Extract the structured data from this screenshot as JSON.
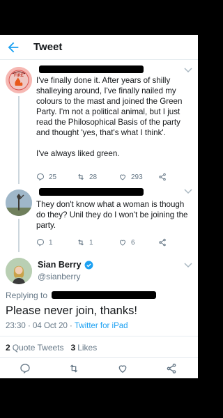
{
  "header": {
    "title": "Tweet"
  },
  "tweet1": {
    "avatar_text": "FIRE",
    "text": "I've finally done it. After years of shilly shalleying around, I've finally nailed my colours to the mast and joined the Green Party. I'm not a political animal, but I just read the Philosophical Basis of the party and thought 'yes, that's what I think'.\n\nI've always liked green.",
    "replies": "25",
    "retweets": "28",
    "likes": "293"
  },
  "tweet2": {
    "text": "They don't know what a woman is though do they? Unil they do I won't be joining the party.",
    "replies": "1",
    "retweets": "1",
    "likes": "6"
  },
  "main": {
    "name": "Sian Berry",
    "handle": "@sianberry",
    "replying_to": "Replying to",
    "text": "Please never join, thanks!",
    "time": "23:30 · 04 Oct 20 · ",
    "source": "Twitter for iPad",
    "quote_count": "2",
    "quote_label": "Quote Tweets",
    "like_count": "3",
    "like_label": "Likes"
  },
  "colors": {
    "accent": "#1da1f2",
    "muted": "#657786",
    "verified": "#1da1f2"
  },
  "icons": [
    "back-arrow-icon",
    "reply-icon",
    "retweet-icon",
    "like-icon",
    "share-icon",
    "chevron-down-icon",
    "verified-icon"
  ]
}
